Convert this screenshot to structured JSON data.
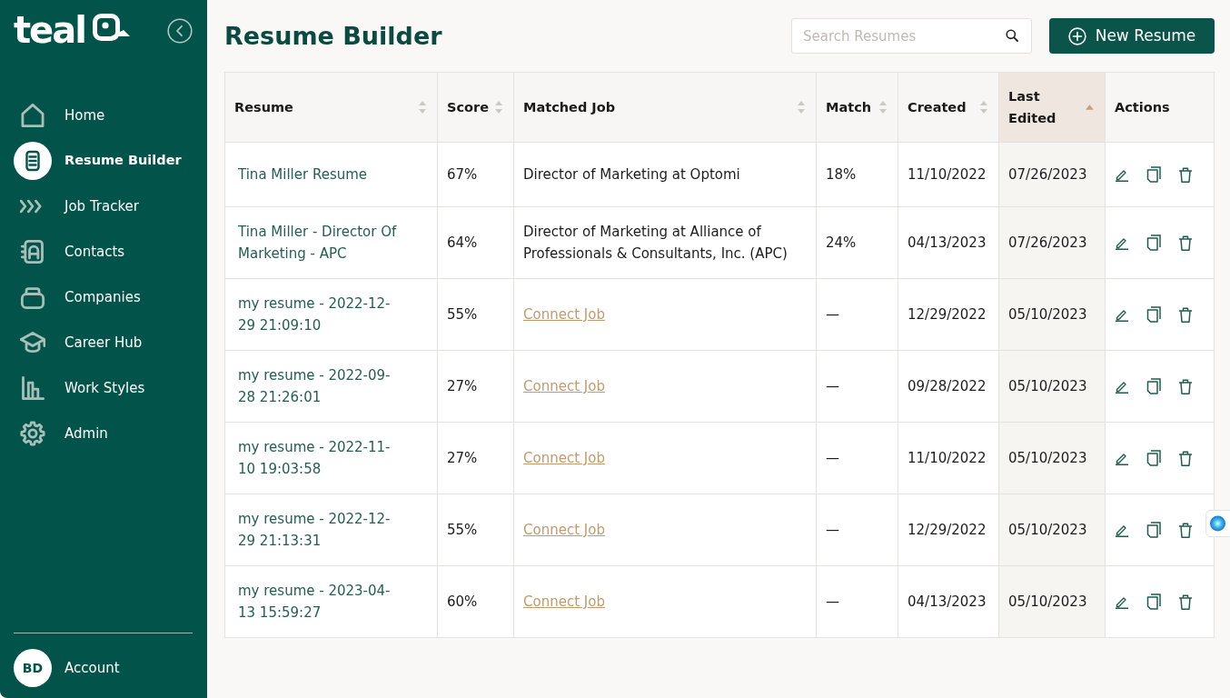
{
  "sidebar": {
    "logo": "teal",
    "nav_items": [
      {
        "label": "Home",
        "selected": false
      },
      {
        "label": "Resume Builder",
        "selected": true
      },
      {
        "label": "Job Tracker",
        "selected": false
      },
      {
        "label": "Contacts",
        "selected": false
      },
      {
        "label": "Companies",
        "selected": false
      },
      {
        "label": "Career Hub",
        "selected": false
      },
      {
        "label": "Work Styles",
        "selected": false
      },
      {
        "label": "Admin",
        "selected": false
      }
    ],
    "account": {
      "initials": "BD",
      "label": "Account"
    }
  },
  "page": {
    "title": "Resume Builder",
    "search": {
      "placeholder": "Search Resumes"
    },
    "new_button": "New Resume"
  },
  "table": {
    "columns": [
      {
        "label": "Resume",
        "sortable": true,
        "sorted": false
      },
      {
        "label": "Score",
        "sortable": true,
        "sorted": false
      },
      {
        "label": "Matched Job",
        "sortable": true,
        "sorted": false
      },
      {
        "label": "Match",
        "sortable": true,
        "sorted": false
      },
      {
        "label": "Created",
        "sortable": true,
        "sorted": false
      },
      {
        "label": "Last Edited",
        "sortable": true,
        "sorted": true
      },
      {
        "label": "Actions",
        "sortable": false,
        "sorted": false
      }
    ],
    "rows": [
      {
        "resume": "Tina Miller Resume",
        "score": "67%",
        "matched_job": {
          "kind": "job",
          "text": "Director of Marketing at Optomi"
        },
        "match": "18%",
        "created": "11/10/2022",
        "last_edited": "07/26/2023"
      },
      {
        "resume": "Tina Miller - Director Of Marketing - APC",
        "score": "64%",
        "matched_job": {
          "kind": "job",
          "text": "Director of Marketing at Alliance of Professionals & Consultants, Inc. (APC)"
        },
        "match": "24%",
        "created": "04/13/2023",
        "last_edited": "07/26/2023"
      },
      {
        "resume": "my resume - 2022-12-29 21:09:10",
        "score": "55%",
        "matched_job": {
          "kind": "connect-link",
          "text": "Connect Job"
        },
        "match": "—",
        "created": "12/29/2022",
        "last_edited": "05/10/2023"
      },
      {
        "resume": "my resume - 2022-09-28 21:26:01",
        "score": "27%",
        "matched_job": {
          "kind": "connect-link",
          "text": "Connect Job"
        },
        "match": "—",
        "created": "09/28/2022",
        "last_edited": "05/10/2023"
      },
      {
        "resume": "my resume - 2022-11-10 19:03:58",
        "score": "27%",
        "matched_job": {
          "kind": "connect-link",
          "text": "Connect Job"
        },
        "match": "—",
        "created": "11/10/2022",
        "last_edited": "05/10/2023"
      },
      {
        "resume": "my resume - 2022-12-29 21:13:31",
        "score": "55%",
        "matched_job": {
          "kind": "connect-link",
          "text": "Connect Job"
        },
        "match": "—",
        "created": "12/29/2022",
        "last_edited": "05/10/2023"
      },
      {
        "resume": "my resume - 2023-04-13 15:59:27",
        "score": "60%",
        "matched_job": {
          "kind": "connect-link",
          "text": "Connect Job"
        },
        "match": "—",
        "created": "04/13/2023",
        "last_edited": "05/10/2023"
      }
    ]
  }
}
